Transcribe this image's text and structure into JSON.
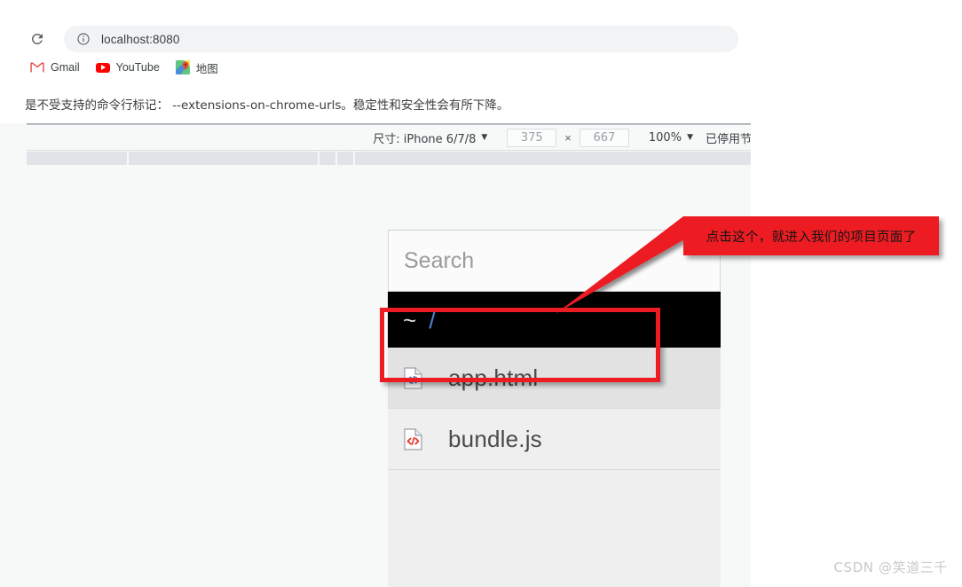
{
  "browser": {
    "reload_icon": "reload-icon",
    "info_icon": "info-circle-icon",
    "url": "localhost:8080",
    "bookmarks": [
      {
        "label": "Gmail",
        "icon": "gmail-icon"
      },
      {
        "label": "YouTube",
        "icon": "youtube-icon"
      },
      {
        "label": "地图",
        "icon": "google-maps-icon"
      }
    ]
  },
  "warning": {
    "text": "是不受支持的命令行标记： --extensions-on-chrome-urls。稳定性和安全性会有所下降。"
  },
  "device_toolbar": {
    "size_label": "尺寸: iPhone 6/7/8",
    "caret": "▼",
    "width": "375",
    "multiply": "×",
    "height": "667",
    "zoom": "100%",
    "zoom_caret": "▼",
    "throttling": "已停用节流"
  },
  "page": {
    "search": {
      "placeholder": "Search",
      "value": ""
    },
    "breadcrumb": {
      "home": "~",
      "separator": "/"
    },
    "files": [
      {
        "name": "app.html",
        "icon": "html-file-icon",
        "icon_color": "#4d82c4",
        "hovered": true
      },
      {
        "name": "bundle.js",
        "icon": "js-file-icon",
        "icon_color": "#e2483c",
        "hovered": false
      }
    ]
  },
  "annotation": {
    "banner_text": "点击这个，就进入我们的项目页面了",
    "color": "#ec1c22"
  },
  "watermark": {
    "text": "CSDN @笑道三千"
  }
}
